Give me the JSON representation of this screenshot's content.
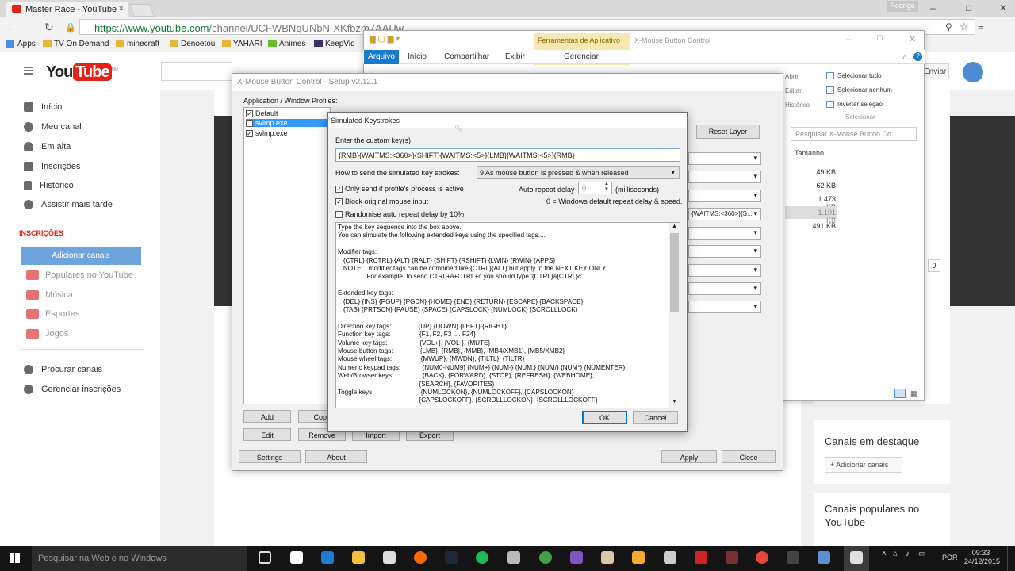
{
  "browser": {
    "tab_title": "Master Race - YouTube",
    "user_chip": "Rodrigo",
    "url_main": "https://www.youtube.com",
    "url_rest": "/channel/UCFWBNqUNbN-XKfbzm7AAUw",
    "bookmarks": [
      "Apps",
      "TV On Demand",
      "minecraft",
      "Denoetou",
      "YAHARI",
      "Animes",
      "KeepVid"
    ]
  },
  "youtube": {
    "logo_you": "You",
    "logo_tube": "Tube",
    "logo_region": "BR",
    "upload": "Enviar",
    "guide": [
      "Início",
      "Meu canal",
      "Em alta",
      "Inscrições",
      "Histórico",
      "Assistir mais tarde"
    ],
    "subs_heading": "INSCRIÇÕES",
    "add_channels": "Adicionar canais",
    "subs": [
      "Populares no YouTube",
      "Música",
      "Esportes",
      "Jogos"
    ],
    "more": [
      "Procurar canais",
      "Gerenciar inscrições"
    ],
    "featured_title": "Canais em destaque",
    "featured_add": "+ Adicionar canais",
    "popular_title": "Canais populares no YouTube",
    "count_badge": "0"
  },
  "explorer": {
    "tools_label": "Ferramentas de Aplicativo",
    "window_title": "X-Mouse Button Control",
    "tabs": [
      "Arquivo",
      "Início",
      "Compartilhar",
      "Exibir",
      "Gerenciar"
    ],
    "ribbon_right": [
      "Selecionar tudo",
      "Selecionar nenhum",
      "Inverter seleção",
      "Selecionar"
    ],
    "ribbon_mid": [
      "Abrir",
      "Editar",
      "Histórico"
    ],
    "search_placeholder": "Pesquisar X-Mouse Button Co...",
    "col_size": "Tamanho",
    "sizes": [
      "49 KB",
      "62 KB",
      "1.473 KB",
      "1.101 KB",
      "491 KB"
    ]
  },
  "setup": {
    "title": "X-Mouse Button Control - Setup v2.12.1",
    "profiles_label": "Application / Window Profiles:",
    "profiles": [
      "Default",
      "svlmp.exe",
      "svlmp.exe"
    ],
    "reset_layer": "Reset Layer",
    "layer_value": "{WAITMS:<360>}{S...",
    "buttons_left": [
      "Add",
      "Copy",
      "Edit",
      "Remove",
      "Import",
      "Export"
    ],
    "buttons_bottom": [
      "Settings",
      "About",
      "Apply",
      "Close"
    ]
  },
  "dialog": {
    "title": "Simulated Keystrokes",
    "enter_label": "Enter the custom key(s)",
    "keys_value": "{RMB}{WAITMS:<360>}{SHIFT}{WAITMS:<5>}{LMB}{WAITMS:<5>}{RMB}",
    "how_label": "How to send the simulated key strokes:",
    "how_value": "9 As mouse button is pressed & when released",
    "chk_only_send": "Only send if profile's process is active",
    "chk_block": "Block original mouse input",
    "chk_randomise": "Randomise auto repeat delay by 10%",
    "repeat_label": "Auto repeat delay",
    "repeat_value": "0",
    "repeat_unit": "(milliseconds)",
    "repeat_note": "0 = Windows default repeat delay & speed.",
    "help_lines": [
      "Type the key sequence into the box above.",
      "You can simulate the following extended keys using the specified tags....",
      "",
      "Modifier tags:",
      "   {CTRL} {RCTRL} {ALT} {RALT} {SHIFT} {RSHIFT} {LWIN} {RWIN} {APPS}",
      "   NOTE:   modifier tags can be combined like {CTRL}{ALT} but apply to the NEXT KEY ONLY.",
      "                For example, to send CTRL+a+CTRL+c you should type '{CTRL}a{CTRL}c'.",
      "",
      "Extended key tags:",
      "   {DEL} {INS} {PGUP} {PGDN} {HOME} {END} {RETURN} {ESCAPE} {BACKSPACE}",
      "   {TAB} {PRTSCN} {PAUSE} {SPACE} {CAPSLOCK} {NUMLOCK} {SCROLLLOCK}",
      "",
      "Direction key tags:               {UP} {DOWN} {LEFT} {RIGHT}",
      "Function key tags:                {F1, F2, F3 .... F24}",
      "Volume key tags:                  {VOL+}, {VOL-}, {MUTE}",
      "Mouse button tags:               {LMB}, {RMB}, {MMB}, {MB4/XMB1}, {MB5/XMB2}",
      "Mouse wheel tags:                {MWUP}, {MWDN}, {TILTL}, {TILTR}",
      "Numeric keypad tags:            {NUM0-NUM9} {NUM+} {NUM-} {NUM.} {NUM/} {NUM*} {NUMENTER}",
      "Web/Browser keys:                {BACK}, {FORWARD}, {STOP}, {REFRESH}, {WEBHOME},",
      "                                             {SEARCH}, {FAVORITES}",
      "Toggle keys:                          {NUMLOCKON}, {NUMLOCKOFF}, {CAPSLOCKON}",
      "                                             {CAPSLOCKOFF}, {SCROLLLOCKON}, {SCROLLLOCKOFF}"
    ],
    "ok": "OK",
    "cancel": "Cancel"
  },
  "taskbar": {
    "search_placeholder": "Pesquisar na Web e no Windows",
    "lang": "POR",
    "time": "09:33",
    "date": "24/12/2015"
  }
}
